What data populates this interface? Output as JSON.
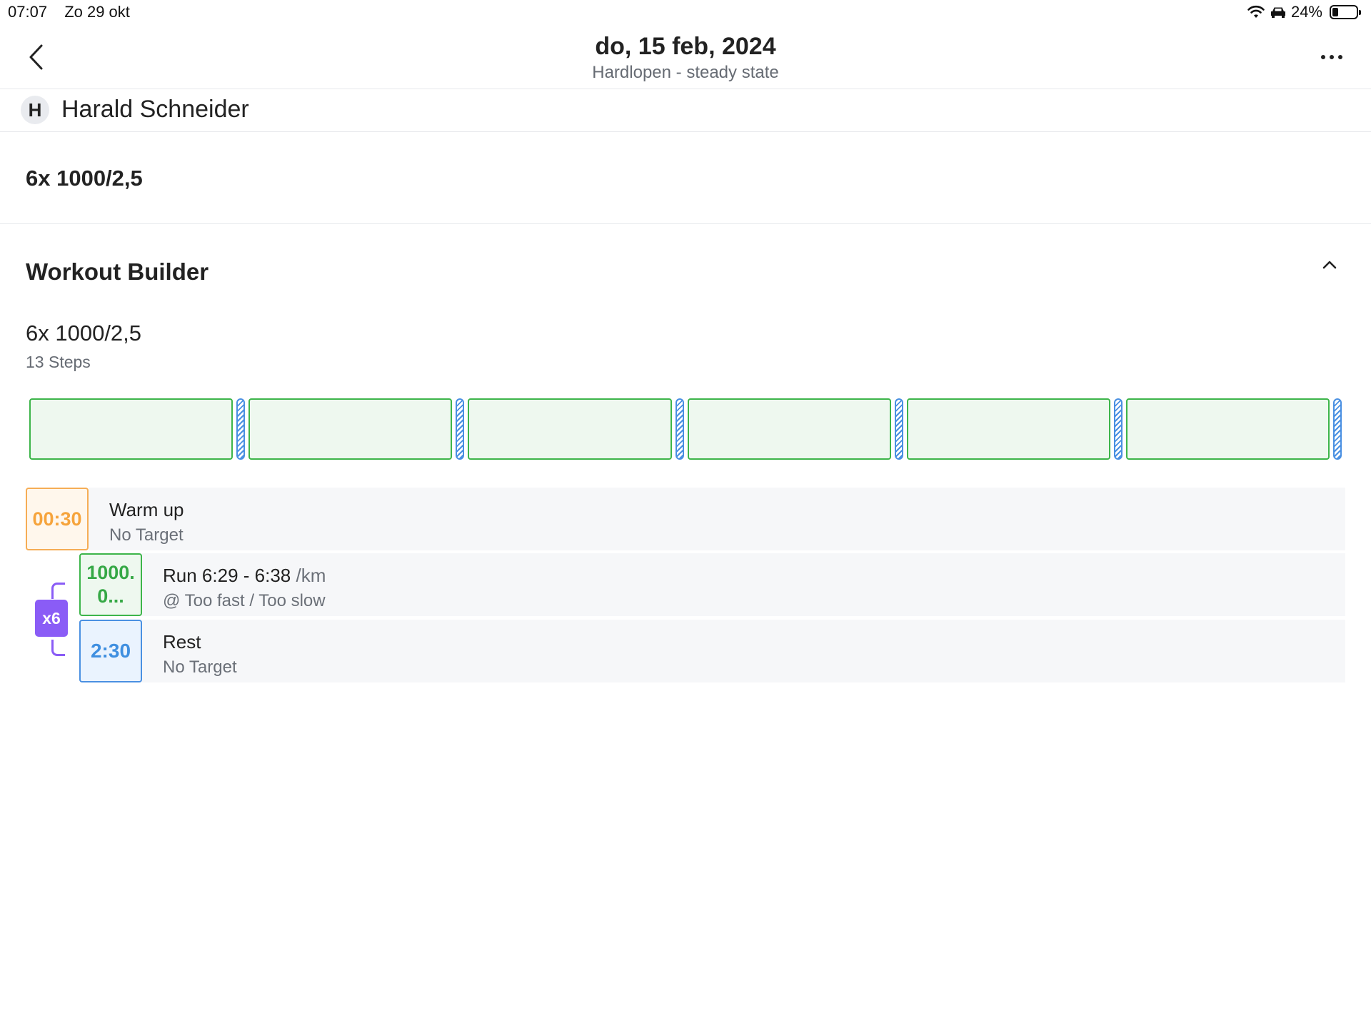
{
  "status_bar": {
    "time": "07:07",
    "date": "Zo 29 okt",
    "battery": "24%",
    "battery_level": 0.24,
    "icons": [
      "wifi-icon",
      "car-icon",
      "battery-icon"
    ]
  },
  "header": {
    "title": "do, 15 feb, 2024",
    "subtitle": "Hardlopen - steady state",
    "back_icon": "chevron-left-icon",
    "more_icon": "more-horizontal-icon"
  },
  "athlete": {
    "initial": "H",
    "name": "Harald Schneider"
  },
  "workout": {
    "title": "6x 1000/2,5"
  },
  "builder": {
    "section_title": "Workout Builder",
    "collapse_icon": "chevron-up-icon",
    "plan_name": "6x 1000/2,5",
    "steps_count": "13 Steps",
    "timeline": {
      "intervals": 6,
      "run_color": "#3db54a",
      "rest_color": "#4a90e2"
    },
    "steps": [
      {
        "badge": "00:30",
        "name": "Warm up",
        "target": "No Target",
        "color": "#f6ad55"
      }
    ],
    "repeat": {
      "label": "x6",
      "color": "#8a5cf6",
      "steps": [
        {
          "badge_line1": "1000.",
          "badge_line2": "0...",
          "name": "Run 6:29 - 6:38",
          "unit": "/km",
          "target": "@ Too fast / Too slow",
          "color": "#3db54a"
        },
        {
          "badge": "2:30",
          "name": "Rest",
          "target": "No Target",
          "color": "#4a90e2"
        }
      ]
    }
  }
}
